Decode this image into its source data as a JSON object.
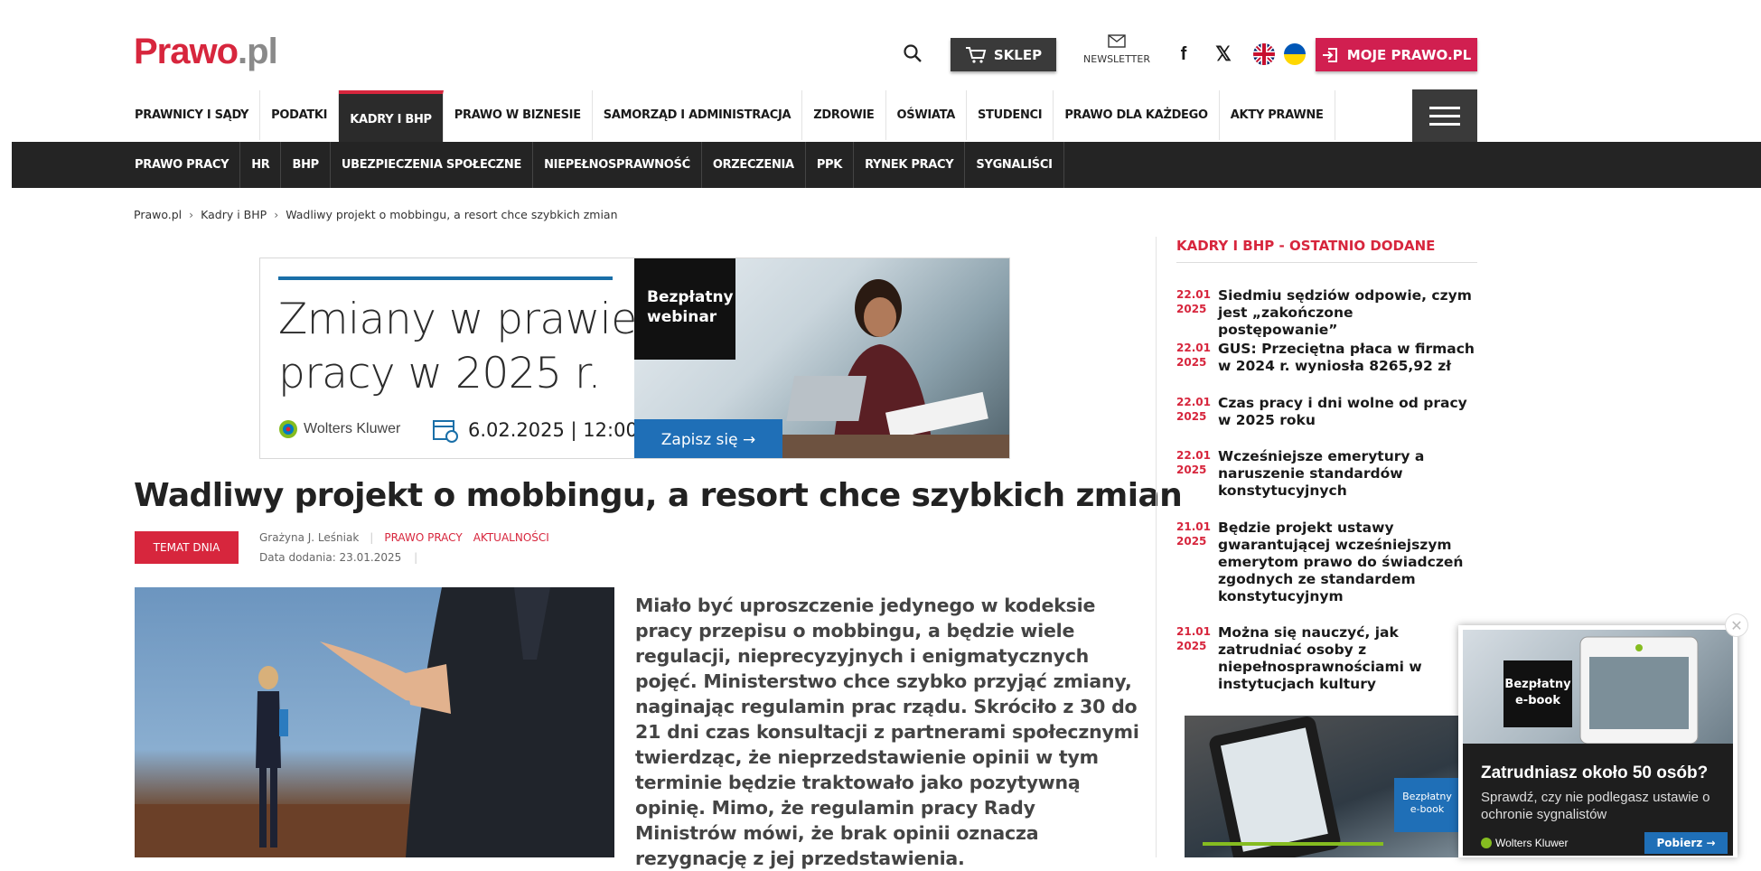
{
  "header": {
    "logo_a": "Prawo",
    "logo_b": ".pl",
    "shop_label": "SKLEP",
    "newsletter_label": "NEWSLETTER",
    "social_f": "f",
    "social_x": "𝕏",
    "moje_label": "MOJE PRAWO.PL"
  },
  "main_nav": [
    "PRAWNICY I SĄDY",
    "PODATKI",
    "KADRY I BHP",
    "PRAWO W BIZNESIE",
    "SAMORZĄD I ADMINISTRACJA",
    "ZDROWIE",
    "OŚWIATA",
    "STUDENCI",
    "PRAWO DLA KAŻDEGO",
    "AKTY PRAWNE"
  ],
  "sub_nav": [
    "PRAWO PRACY",
    "HR",
    "BHP",
    "UBEZPIECZENIA SPOŁECZNE",
    "NIEPEŁNOSPRAWNOŚĆ",
    "ORZECZENIA",
    "PPK",
    "RYNEK PRACY",
    "SYGNALIŚCI"
  ],
  "breadcrumb": {
    "home": "Prawo.pl",
    "section": "Kadry i BHP",
    "current": "Wadliwy projekt o mobbingu, a resort chce szybkich zmian"
  },
  "banner": {
    "headline_1": "Zmiany w prawie",
    "headline_2": "pracy w 2025 r.",
    "brand": "Wolters Kluwer",
    "date": "6.02.2025 | 12:00",
    "badge_1": "Bezpłatny",
    "badge_2": "webinar",
    "cta": "Zapisz się →"
  },
  "article": {
    "title": "Wadliwy projekt o mobbingu, a resort chce szybkich zmian",
    "tag": "TEMAT DNIA",
    "author": "Grażyna J. Leśniak",
    "cat1": "PRAWO PRACY",
    "cat2": "AKTUALNOŚCI",
    "date": "Data dodania: 23.01.2025",
    "lead": "Miało być uproszczenie jedynego w kodeksie pracy przepisu o mobbingu, a będzie wiele regulacji, nieprecyzyjnych i enigmatycznych pojęć. Ministerstwo chce szybko przyjąć zmiany, naginając regulamin prac rządu. Skróciło z 30 do 21 dni czas konsultacji z partnerami społecznymi twierdząc, że nieprzedstawienie opinii w tym terminie będzie traktowało jako pozytywną opinię. Mimo, że regulamin pracy Rady Ministrów mówi, że brak opinii oznacza rezygnację z jej przedstawienia."
  },
  "sidebar": {
    "heading": "KADRY I BHP - OSTATNIO DODANE",
    "items": [
      {
        "day": "22.01",
        "year": "2025",
        "title": "Siedmiu sędziów odpowie, czym jest „zakończone postępowanie”"
      },
      {
        "day": "22.01",
        "year": "2025",
        "title": "GUS: Przeciętna płaca w firmach w 2024 r. wyniosła 8265,92 zł"
      },
      {
        "day": "22.01",
        "year": "2025",
        "title": "Czas pracy i dni wolne od pracy w 2025 roku"
      },
      {
        "day": "22.01",
        "year": "2025",
        "title": "Wcześniejsze emerytury a naruszenie standardów konstytucyjnych"
      },
      {
        "day": "21.01",
        "year": "2025",
        "title": "Będzie projekt ustawy gwarantującej wcześniejszym emerytom prawo do świadczeń zgodnych ze standardem konstytucyjnym"
      },
      {
        "day": "21.01",
        "year": "2025",
        "title": "Można się nauczyć, jak zatrudniać osoby z niepełnosprawnościami w instytucjach kultury"
      }
    ],
    "ad_label_1": "Bezpłatny",
    "ad_label_2": "e-book"
  },
  "popup": {
    "badge_1": "Bezpłatny",
    "badge_2": "e-book",
    "heading": "Zatrudniasz około 50 osób?",
    "text": "Sprawdź, czy nie podlegasz ustawie o ochronie sygnalistów",
    "brand": "Wolters Kluwer",
    "download": "Pobierz →",
    "close": "✕"
  }
}
